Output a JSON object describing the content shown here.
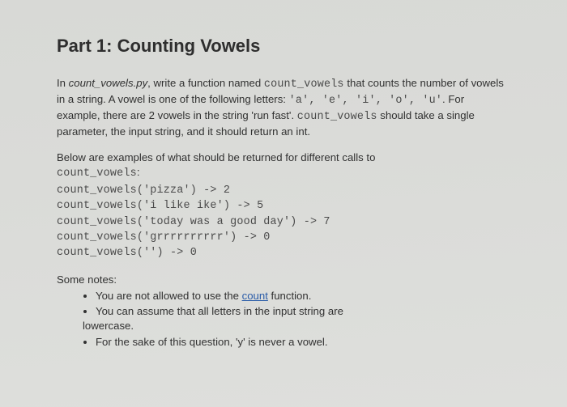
{
  "title": "Part 1: Counting Vowels",
  "intro": {
    "seg1": "In ",
    "filename": "count_vowels.py",
    "seg2": ", write a function named ",
    "fn1": "count_vowels",
    "seg3": " that counts the number of vowels in a string. A vowel is one of the following letters: ",
    "letters": "'a', 'e', 'i', 'o', 'u'",
    "seg4": ". For example, there are 2 vowels in the string 'run fast'. ",
    "fn2": "count_vowels",
    "seg5": "  should take a single parameter, the input string, and it should return an int."
  },
  "examples_intro": {
    "seg1": "Below are examples of what should be returned for different calls to ",
    "fn": "count_vowels",
    "seg2": ":"
  },
  "examples": "count_vowels('pizza') -> 2\ncount_vowels('i like ike') -> 5\ncount_vowels('today was a good day') -> 7\ncount_vowels('grrrrrrrrrr') -> 0\ncount_vowels('') -> 0",
  "notes": {
    "heading": "Some notes:",
    "item1a": "You are not allowed to use the ",
    "item1_link": "count",
    "item1b": " function.",
    "item2a": "You can assume that all letters in the input string are",
    "item2b": "lowercase.",
    "item3": "For the sake of this question, 'y' is never a vowel."
  }
}
